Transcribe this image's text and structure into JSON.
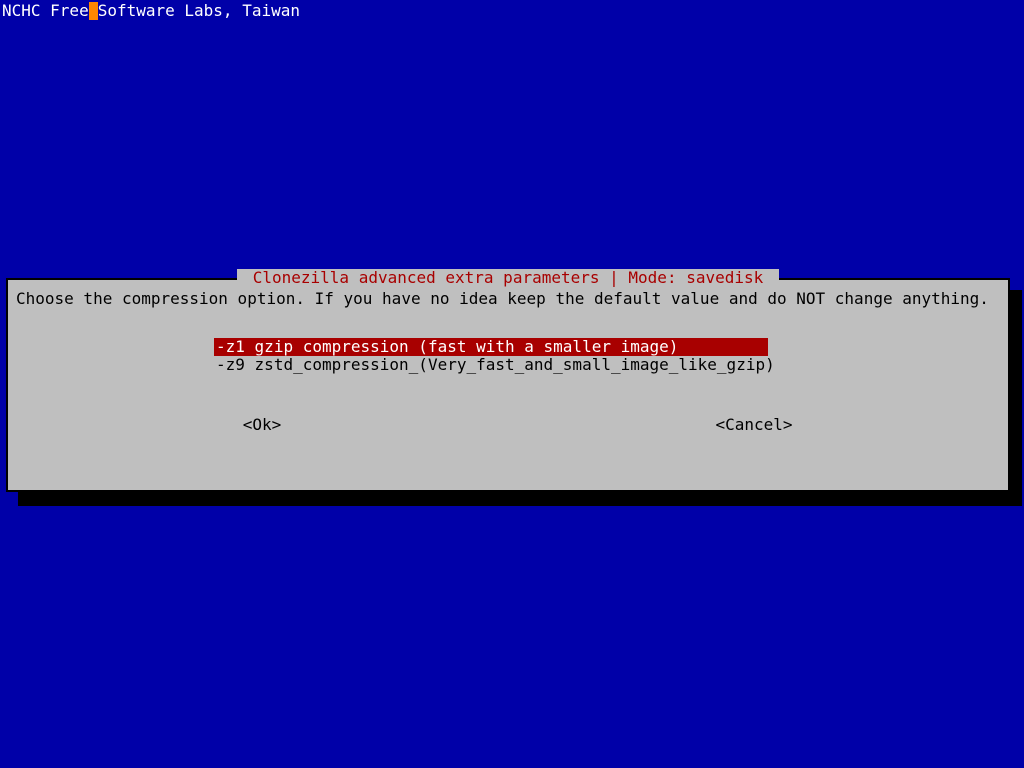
{
  "header": {
    "pre": "NCHC Free",
    "post": "Software Labs, Taiwan"
  },
  "dialog": {
    "title": " Clonezilla advanced extra parameters | Mode: savedisk ",
    "prompt": "Choose the compression option. If you have no idea keep the default value and do NOT change anything.",
    "options": [
      {
        "flag": "-z1",
        "label": "gzip compression (fast with a smaller image)",
        "selected": true
      },
      {
        "flag": "-z9",
        "label": "zstd_compression_(Very_fast_and_small_image_like_gzip)",
        "selected": false
      }
    ],
    "ok_label": "<Ok>",
    "cancel_label": "<Cancel>"
  }
}
